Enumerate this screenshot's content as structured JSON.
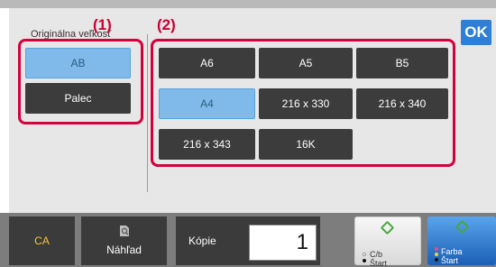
{
  "header": {
    "section_title": "Originálna veľkosť"
  },
  "markers": {
    "group1": "(1)",
    "group2": "(2)"
  },
  "ok_button": {
    "label": "OK"
  },
  "type_buttons": [
    "AB",
    "Palec"
  ],
  "size_buttons": [
    "A6",
    "A5",
    "B5",
    "A4",
    "216 x 330",
    "216 x 340",
    "216 x 343",
    "16K"
  ],
  "selected": {
    "type": "AB",
    "size": "A4"
  },
  "bottom": {
    "ca_label": "CA",
    "preview_label": "Náhľad",
    "copies_label": "Kópie",
    "copies_value": "1",
    "start_bw_line1": "C/b",
    "start_bw_line2": "Štart",
    "start_color_line1": "Farba",
    "start_color_line2": "Štart"
  },
  "colors": {
    "highlight_border": "#d4003c",
    "selected_button": "#7fbaea",
    "button_dark": "#3c3c3c",
    "ok_blue": "#2f7fd6",
    "ca_text": "#f5c63a",
    "start_icon_green": "#49a63f"
  }
}
